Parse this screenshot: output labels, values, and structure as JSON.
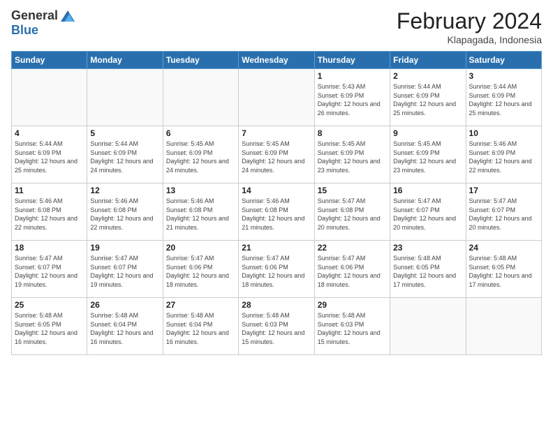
{
  "logo": {
    "general": "General",
    "blue": "Blue"
  },
  "title": "February 2024",
  "subtitle": "Klapagada, Indonesia",
  "days_header": [
    "Sunday",
    "Monday",
    "Tuesday",
    "Wednesday",
    "Thursday",
    "Friday",
    "Saturday"
  ],
  "weeks": [
    [
      {
        "day": "",
        "info": ""
      },
      {
        "day": "",
        "info": ""
      },
      {
        "day": "",
        "info": ""
      },
      {
        "day": "",
        "info": ""
      },
      {
        "day": "1",
        "info": "Sunrise: 5:43 AM\nSunset: 6:09 PM\nDaylight: 12 hours and 26 minutes."
      },
      {
        "day": "2",
        "info": "Sunrise: 5:44 AM\nSunset: 6:09 PM\nDaylight: 12 hours and 25 minutes."
      },
      {
        "day": "3",
        "info": "Sunrise: 5:44 AM\nSunset: 6:09 PM\nDaylight: 12 hours and 25 minutes."
      }
    ],
    [
      {
        "day": "4",
        "info": "Sunrise: 5:44 AM\nSunset: 6:09 PM\nDaylight: 12 hours and 25 minutes."
      },
      {
        "day": "5",
        "info": "Sunrise: 5:44 AM\nSunset: 6:09 PM\nDaylight: 12 hours and 24 minutes."
      },
      {
        "day": "6",
        "info": "Sunrise: 5:45 AM\nSunset: 6:09 PM\nDaylight: 12 hours and 24 minutes."
      },
      {
        "day": "7",
        "info": "Sunrise: 5:45 AM\nSunset: 6:09 PM\nDaylight: 12 hours and 24 minutes."
      },
      {
        "day": "8",
        "info": "Sunrise: 5:45 AM\nSunset: 6:09 PM\nDaylight: 12 hours and 23 minutes."
      },
      {
        "day": "9",
        "info": "Sunrise: 5:45 AM\nSunset: 6:09 PM\nDaylight: 12 hours and 23 minutes."
      },
      {
        "day": "10",
        "info": "Sunrise: 5:46 AM\nSunset: 6:09 PM\nDaylight: 12 hours and 22 minutes."
      }
    ],
    [
      {
        "day": "11",
        "info": "Sunrise: 5:46 AM\nSunset: 6:08 PM\nDaylight: 12 hours and 22 minutes."
      },
      {
        "day": "12",
        "info": "Sunrise: 5:46 AM\nSunset: 6:08 PM\nDaylight: 12 hours and 22 minutes."
      },
      {
        "day": "13",
        "info": "Sunrise: 5:46 AM\nSunset: 6:08 PM\nDaylight: 12 hours and 21 minutes."
      },
      {
        "day": "14",
        "info": "Sunrise: 5:46 AM\nSunset: 6:08 PM\nDaylight: 12 hours and 21 minutes."
      },
      {
        "day": "15",
        "info": "Sunrise: 5:47 AM\nSunset: 6:08 PM\nDaylight: 12 hours and 20 minutes."
      },
      {
        "day": "16",
        "info": "Sunrise: 5:47 AM\nSunset: 6:07 PM\nDaylight: 12 hours and 20 minutes."
      },
      {
        "day": "17",
        "info": "Sunrise: 5:47 AM\nSunset: 6:07 PM\nDaylight: 12 hours and 20 minutes."
      }
    ],
    [
      {
        "day": "18",
        "info": "Sunrise: 5:47 AM\nSunset: 6:07 PM\nDaylight: 12 hours and 19 minutes."
      },
      {
        "day": "19",
        "info": "Sunrise: 5:47 AM\nSunset: 6:07 PM\nDaylight: 12 hours and 19 minutes."
      },
      {
        "day": "20",
        "info": "Sunrise: 5:47 AM\nSunset: 6:06 PM\nDaylight: 12 hours and 18 minutes."
      },
      {
        "day": "21",
        "info": "Sunrise: 5:47 AM\nSunset: 6:06 PM\nDaylight: 12 hours and 18 minutes."
      },
      {
        "day": "22",
        "info": "Sunrise: 5:47 AM\nSunset: 6:06 PM\nDaylight: 12 hours and 18 minutes."
      },
      {
        "day": "23",
        "info": "Sunrise: 5:48 AM\nSunset: 6:05 PM\nDaylight: 12 hours and 17 minutes."
      },
      {
        "day": "24",
        "info": "Sunrise: 5:48 AM\nSunset: 6:05 PM\nDaylight: 12 hours and 17 minutes."
      }
    ],
    [
      {
        "day": "25",
        "info": "Sunrise: 5:48 AM\nSunset: 6:05 PM\nDaylight: 12 hours and 16 minutes."
      },
      {
        "day": "26",
        "info": "Sunrise: 5:48 AM\nSunset: 6:04 PM\nDaylight: 12 hours and 16 minutes."
      },
      {
        "day": "27",
        "info": "Sunrise: 5:48 AM\nSunset: 6:04 PM\nDaylight: 12 hours and 16 minutes."
      },
      {
        "day": "28",
        "info": "Sunrise: 5:48 AM\nSunset: 6:03 PM\nDaylight: 12 hours and 15 minutes."
      },
      {
        "day": "29",
        "info": "Sunrise: 5:48 AM\nSunset: 6:03 PM\nDaylight: 12 hours and 15 minutes."
      },
      {
        "day": "",
        "info": ""
      },
      {
        "day": "",
        "info": ""
      }
    ]
  ]
}
